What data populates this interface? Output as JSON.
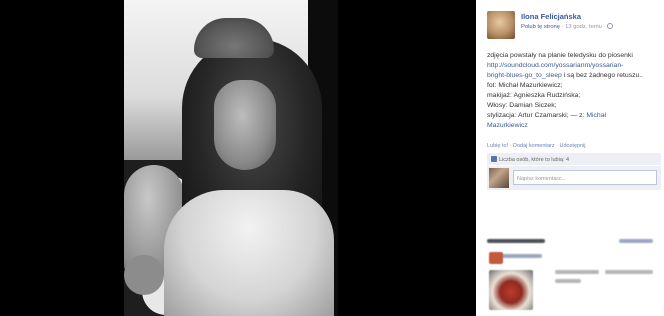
{
  "post": {
    "page_name": "Ilona Felicjańska",
    "like_page": "Polub tę stronę",
    "time": "· 13 godz. temu ·",
    "caption": [
      "zdjęcia powstały na planie teledysku do piosenki",
      "http://soundcloud.com/yossarianm/yossarian-",
      "bright-blues-go_to_sleep",
      " i są bez żadnego retuszu..",
      "fot: Michał Mazurkiewicz;",
      "makijaż: Agnieszka Rudzińska;",
      "Włosy: Damian Siczek;",
      "stylizacja: Artur Czamarski;",
      " — z: ",
      "Michał",
      "Mazurkiewicz"
    ],
    "actions": {
      "like": "Lubię to!",
      "comment": "Dodaj komentarz",
      "share": "Udostępnij",
      "separator": "·"
    },
    "likes_text": "Liczba osób, które to lubią: 4",
    "comment_placeholder": "Napisz komentarz..."
  },
  "icons": {
    "globe": "globe-icon",
    "thumb": "thumbs-up-icon"
  },
  "colors": {
    "link": "#3b5998",
    "panel_bg": "#edeff4"
  }
}
